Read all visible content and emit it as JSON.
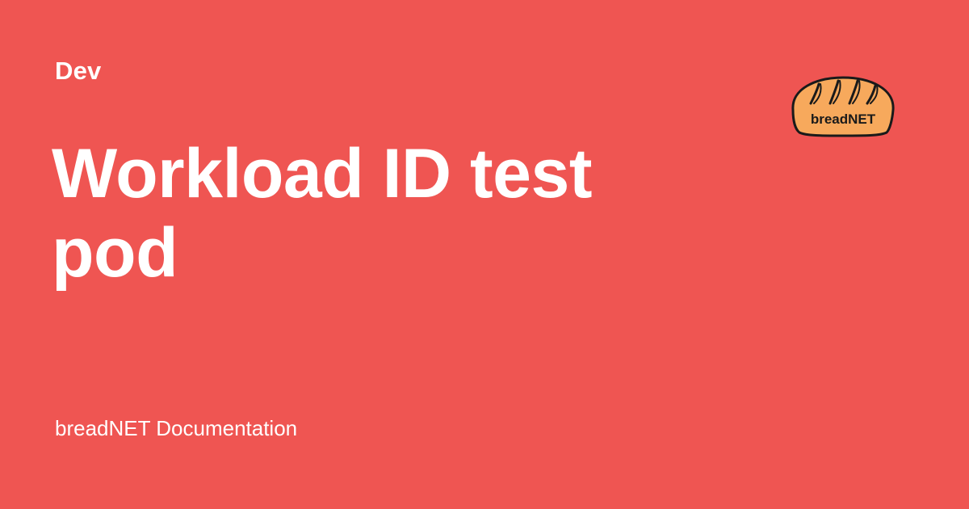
{
  "section": {
    "label": "Dev"
  },
  "page": {
    "title": "Workload ID test pod"
  },
  "site": {
    "name": "breadNET Documentation"
  },
  "logo": {
    "text": "breadNET",
    "icon": "bread-loaf-icon"
  },
  "colors": {
    "background": "#ef5552",
    "text": "#ffffff",
    "logo_fill": "#f7a95c",
    "logo_outline": "#1a1a1a"
  }
}
